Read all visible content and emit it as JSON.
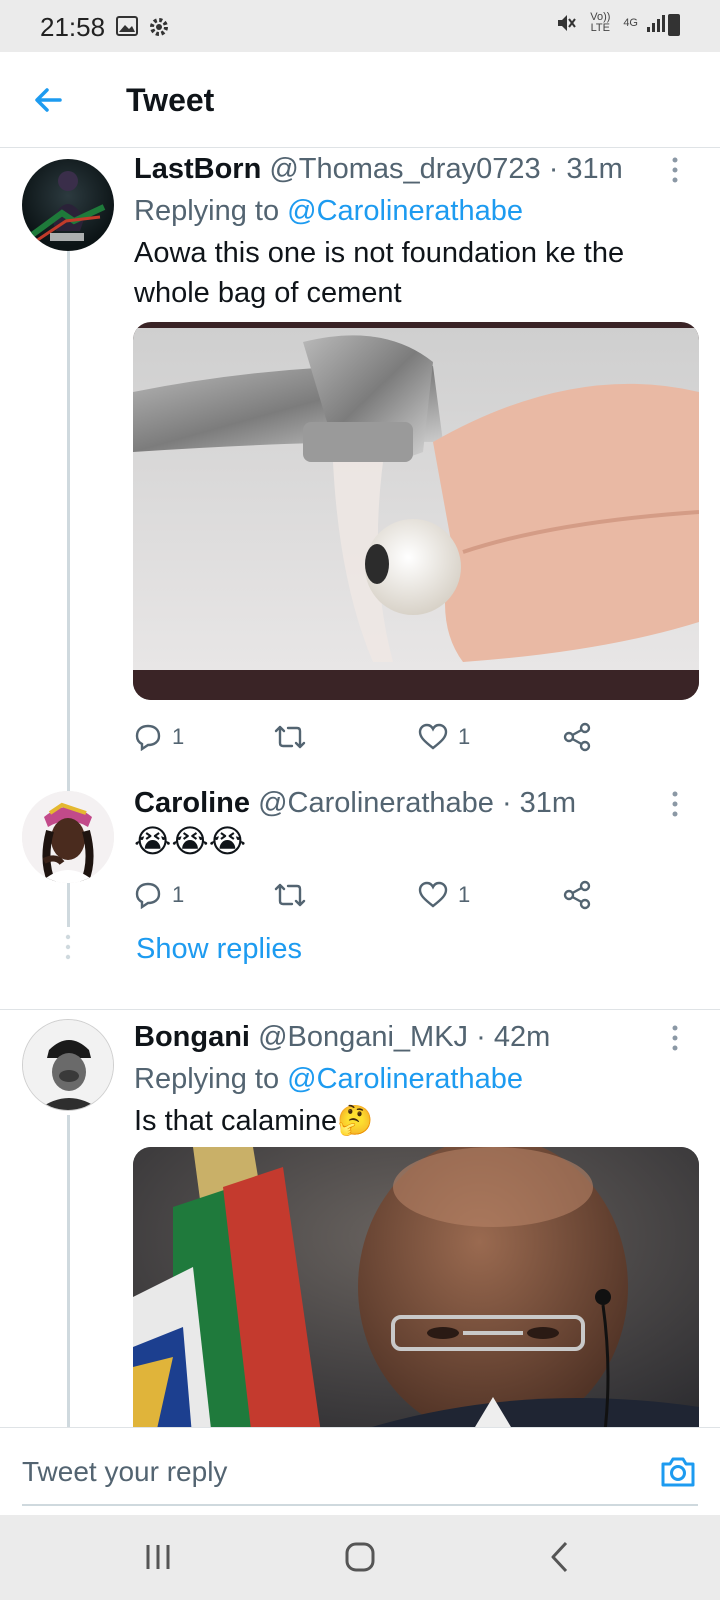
{
  "status_bar": {
    "time": "21:58",
    "icons_left": [
      "image-icon",
      "gear-icon"
    ],
    "icons_right": [
      "mute-icon",
      "volte-icon",
      "4g-icon",
      "signal-icon",
      "battery-icon"
    ],
    "volte_label": "Vo)) LTE",
    "network_label": "4G"
  },
  "header": {
    "back_icon": "back-arrow-icon",
    "title": "Tweet"
  },
  "tweets": [
    {
      "name": "LastBorn",
      "handle": "@Thomas_dray0723",
      "time": "· 31m",
      "replying_prefix": "Replying to ",
      "replying_to": "@Carolinerathabe",
      "text": "Aowa this one is not foundation ke the whole bag of cement",
      "media": "photo-tap-water-pearl",
      "reply_count": "1",
      "retweet_count": "",
      "like_count": "1"
    },
    {
      "name": "Caroline",
      "handle": "@Carolinerathabe",
      "time": "· 31m",
      "text": "😭😭😭",
      "reply_count": "1",
      "retweet_count": "",
      "like_count": "1",
      "show_replies": "Show replies"
    },
    {
      "name": "Bongani",
      "handle": "@Bongani_MKJ",
      "time": "· 42m",
      "replying_prefix": "Replying to ",
      "replying_to": "@Carolinerathabe",
      "text": "Is that calamine🤔",
      "media": "photo-man-with-flag"
    }
  ],
  "composer": {
    "placeholder": "Tweet your reply",
    "camera_icon": "camera-icon"
  },
  "nav_bar": {
    "buttons": [
      "recent-apps-icon",
      "home-icon",
      "back-icon"
    ]
  },
  "colors": {
    "accent": "#1d9bf0",
    "text": "#0f1419",
    "secondary_text": "#536471",
    "divider": "#dfe3e6",
    "system_bar": "#ebebeb"
  }
}
